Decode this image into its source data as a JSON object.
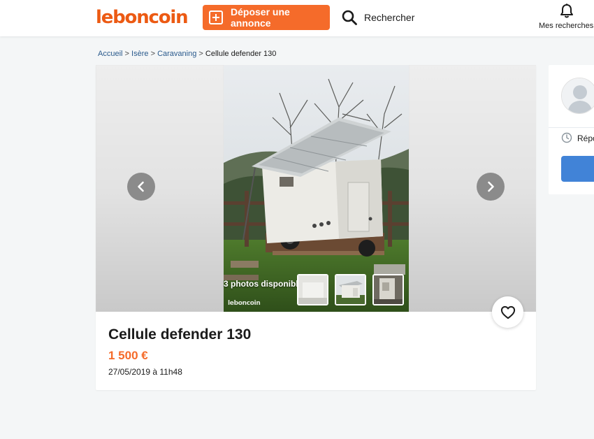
{
  "header": {
    "logo": "leboncoin",
    "post_ad_label": "Déposer une annonce",
    "search_label": "Rechercher",
    "saved_searches_label": "Mes recherches"
  },
  "breadcrumb": {
    "items": [
      "Accueil",
      "Isère",
      "Caravaning"
    ],
    "current": "Cellule defender 130",
    "separator": ">"
  },
  "gallery": {
    "photo_count_label": "3 photos disponibles",
    "watermark": "leboncoin",
    "thumbnail_count": 3
  },
  "ad": {
    "title": "Cellule defender 130",
    "price": "1 500 €",
    "date": "27/05/2019 à 11h48"
  },
  "seller": {
    "reply_text": "Répo"
  },
  "colors": {
    "brand_orange": "#f56b2a",
    "logo_orange": "#ec5a13",
    "link_blue": "#2a5a8c",
    "contact_blue": "#4183d7"
  },
  "icons": [
    "plus-square-icon",
    "search-icon",
    "bell-icon",
    "chevron-left-icon",
    "chevron-right-icon",
    "heart-icon",
    "avatar-icon",
    "clock-icon"
  ]
}
